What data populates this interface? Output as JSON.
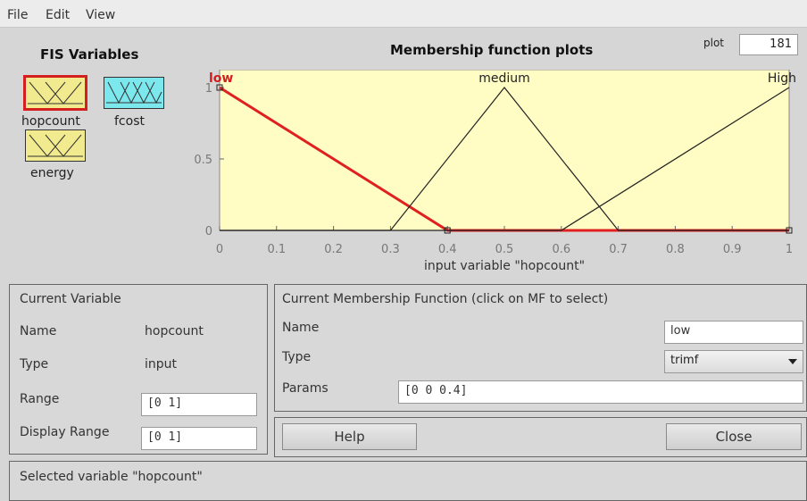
{
  "menu": {
    "items": [
      "File",
      "Edit",
      "View"
    ]
  },
  "fis_variables": {
    "title": "FIS Variables",
    "variables": [
      {
        "name": "hopcount",
        "color": "#f2ea8e",
        "selected": true,
        "icon": "trimf-pair-icon"
      },
      {
        "name": "fcost",
        "color": "#7ce8ee",
        "selected": false,
        "icon": "trimf-triple-icon"
      },
      {
        "name": "energy",
        "color": "#f2ea8e",
        "selected": false,
        "icon": "trimf-pair-icon"
      }
    ]
  },
  "plot": {
    "title": "Membership function plots",
    "points_label": "plot",
    "points_value": "181",
    "xlabel": "input variable \"hopcount\""
  },
  "chart_data": {
    "type": "line",
    "title": "Membership function plots",
    "xlabel": "input variable \"hopcount\"",
    "ylabel": "",
    "xlim": [
      0,
      1
    ],
    "ylim": [
      0,
      1
    ],
    "xticks": [
      "0",
      "0.1",
      "0.2",
      "0.3",
      "0.4",
      "0.5",
      "0.6",
      "0.7",
      "0.8",
      "0.9",
      "1"
    ],
    "yticks": [
      "0",
      "0.5",
      "1"
    ],
    "background": "#fffcc4",
    "series": [
      {
        "name": "low",
        "params": [
          0,
          0,
          0.4
        ],
        "points": [
          [
            0,
            1
          ],
          [
            0.4,
            0
          ],
          [
            1,
            0
          ]
        ],
        "color": "#e02020",
        "selected": true
      },
      {
        "name": "medium",
        "params": [
          0.3,
          0.5,
          0.7
        ],
        "points": [
          [
            0,
            0
          ],
          [
            0.3,
            0
          ],
          [
            0.5,
            1
          ],
          [
            0.7,
            0
          ],
          [
            1,
            0
          ]
        ],
        "color": "#222222",
        "selected": false
      },
      {
        "name": "High",
        "params": [
          0.6,
          1,
          1
        ],
        "points": [
          [
            0,
            0
          ],
          [
            0.6,
            0
          ],
          [
            1,
            1
          ]
        ],
        "color": "#222222",
        "selected": false
      }
    ]
  },
  "current_variable": {
    "header": "Current Variable",
    "name_label": "Name",
    "name_value": "hopcount",
    "type_label": "Type",
    "type_value": "input",
    "range_label": "Range",
    "range_value": "[0 1]",
    "display_range_label": "Display Range",
    "display_range_value": "[0 1]"
  },
  "current_mf": {
    "header": "Current Membership Function (click on MF to select)",
    "name_label": "Name",
    "name_value": "low",
    "type_label": "Type",
    "type_value": "trimf",
    "params_label": "Params",
    "params_value": "[0 0 0.4]"
  },
  "buttons": {
    "help": "Help",
    "close": "Close"
  },
  "status": {
    "text": "Selected variable \"hopcount\""
  }
}
